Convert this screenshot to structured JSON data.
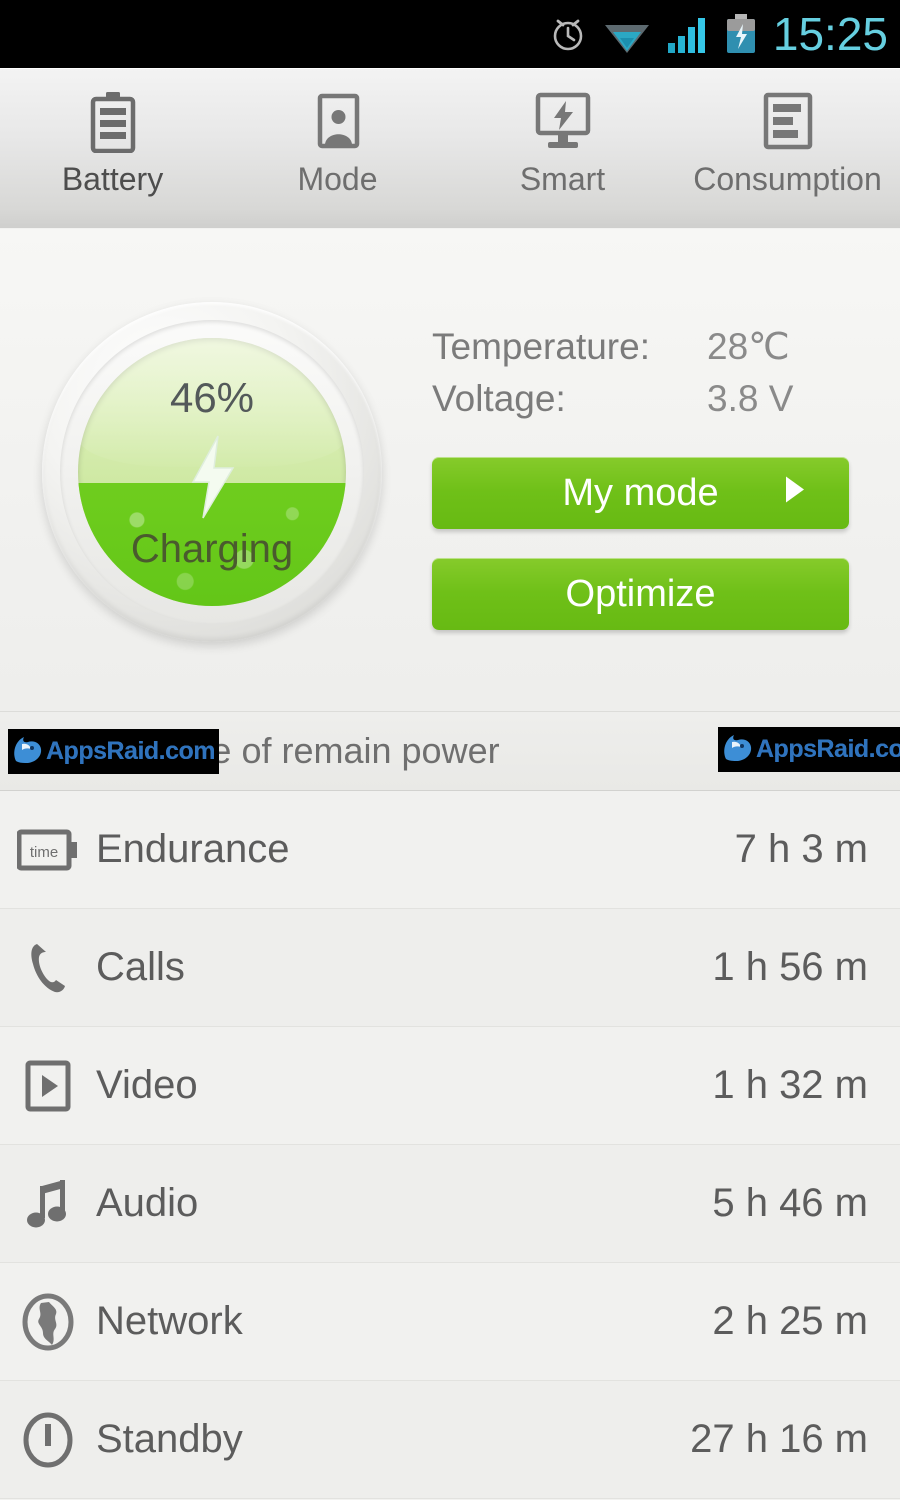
{
  "statusbar": {
    "time": "15:25",
    "icons": [
      "alarm-clock-icon",
      "wifi-icon",
      "signal-bars-icon",
      "battery-charging-icon"
    ],
    "clock_color": "#66cfe0"
  },
  "tabs": [
    {
      "label": "Battery",
      "icon": "battery-icon",
      "active": true
    },
    {
      "label": "Mode",
      "icon": "portrait-person-icon",
      "active": false
    },
    {
      "label": "Smart",
      "icon": "monitor-bolt-icon",
      "active": false
    },
    {
      "label": "Consumption",
      "icon": "bar-chart-document-icon",
      "active": false
    }
  ],
  "accent_color": "#7ec81c",
  "gauge": {
    "percent_label": "46%",
    "percent_value": 46,
    "status_label": "Charging",
    "bolt_icon": "lightning-bolt-icon",
    "fill_color": "#6ac71b",
    "empty_color": "#d5eaa8"
  },
  "info": [
    {
      "label": "Temperature:",
      "value": "28℃"
    },
    {
      "label": "Voltage:",
      "value": "3.8 V"
    }
  ],
  "buttons": {
    "my_mode": {
      "label": "My mode",
      "arrow_icon": "play-arrow-right-icon"
    },
    "optimize": {
      "label": "Optimize"
    }
  },
  "section": {
    "header": "Available time of remain power",
    "header_visible": "able time of remain power"
  },
  "list": [
    {
      "label": "Endurance",
      "value": "7 h 3 m",
      "icon": "battery-time-icon"
    },
    {
      "label": "Calls",
      "value": "1 h 56 m",
      "icon": "phone-handset-icon"
    },
    {
      "label": "Video",
      "value": "1 h 32 m",
      "icon": "video-play-icon"
    },
    {
      "label": "Audio",
      "value": "5 h 46 m",
      "icon": "music-note-icon"
    },
    {
      "label": "Network",
      "value": "2 h 25 m",
      "icon": "globe-icon"
    },
    {
      "label": "Standby",
      "value": "27 h 16 m",
      "icon": "power-standby-icon"
    }
  ],
  "watermark": {
    "text": "AppsRaid.com",
    "logo": "wolf-head-logo-icon"
  }
}
